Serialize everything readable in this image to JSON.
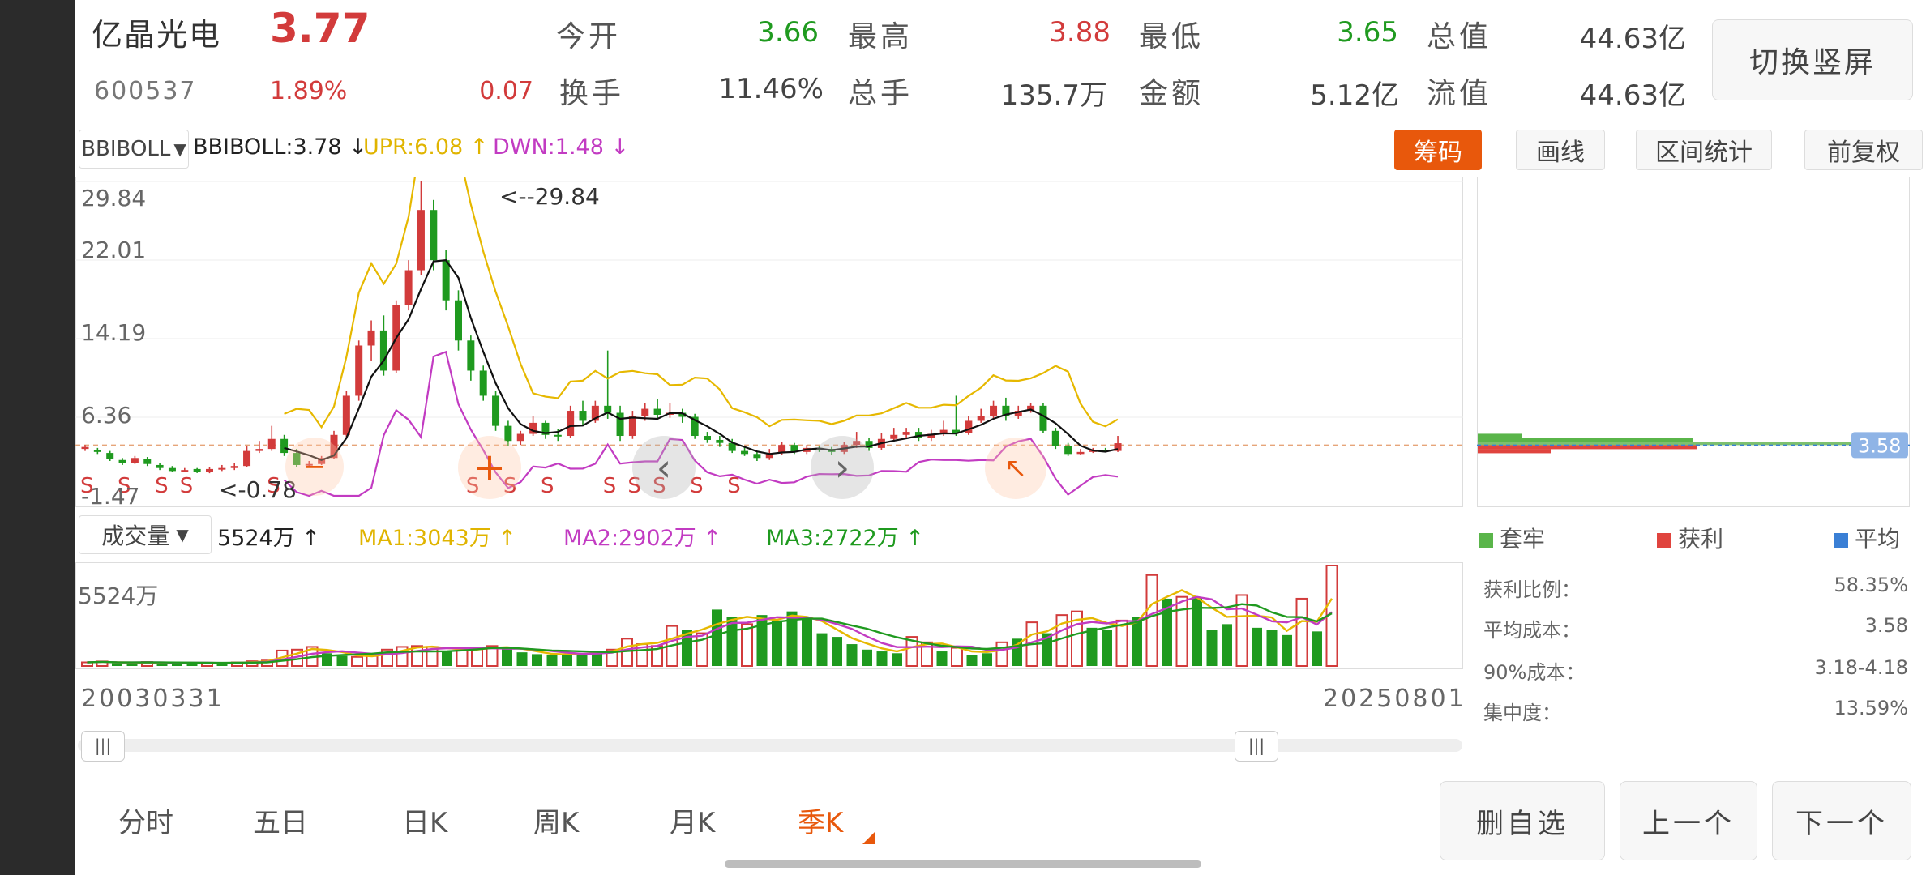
{
  "quote": {
    "name": "亿晶光电",
    "price": "3.77",
    "code": "600537",
    "change_pct": "1.89%",
    "change": "0.07",
    "open_label": "今开",
    "open": "3.66",
    "high_label": "最高",
    "high": "3.88",
    "low_label": "最低",
    "low": "3.65",
    "total_mv_label": "总值",
    "total_mv": "44.63亿",
    "turnover_label": "换手",
    "turnover": "11.46%",
    "volume_label": "总手",
    "volume": "135.7万",
    "amount_label": "金额",
    "amount": "5.12亿",
    "float_mv_label": "流值",
    "float_mv": "44.63亿",
    "switch_btn": "切换竖屏"
  },
  "indicator": {
    "selector": "BBIBOLL",
    "bbiboll": "BBIBOLL:3.78 ↓",
    "upr": "UPR:6.08 ↑",
    "dwn": "DWN:1.48 ↓",
    "buttons": [
      "筹码",
      "画线",
      "区间统计",
      "前复权"
    ]
  },
  "volume_bar": {
    "selector": "成交量",
    "vol": "5524万 ↑",
    "ma1": "MA1:3043万 ↑",
    "ma2": "MA2:2902万 ↑",
    "ma3": "MA3:2722万 ↑",
    "axis_max": "5524万"
  },
  "colors": {
    "up": "#d23b3b",
    "down": "#1f9a1f",
    "boll_upper": "#e6b800",
    "boll_mid": "#111111",
    "boll_lower": "#c23bc2",
    "accent": "#e8580c"
  },
  "chart_data": {
    "type": "candlestick",
    "period": "季K",
    "y_ticks": [
      "29.84",
      "22.01",
      "14.19",
      "6.36",
      "-1.47"
    ],
    "ylim": [
      -1.47,
      29.84
    ],
    "x_start": "20030331",
    "x_end": "20250801",
    "max_label": "<--29.84",
    "min_label": "<-0.78",
    "current_price_line": 3.58,
    "signals": [
      "S",
      "S",
      "S",
      "S",
      "S",
      "S",
      "S",
      "S",
      "S",
      "S",
      "S",
      "S",
      "S"
    ],
    "candles": [
      [
        3.2,
        3.4,
        3.6,
        3.0
      ],
      [
        3.1,
        2.9,
        3.3,
        2.7
      ],
      [
        2.8,
        2.2,
        3.0,
        2.0
      ],
      [
        2.1,
        1.8,
        2.3,
        1.6
      ],
      [
        1.8,
        2.3,
        2.5,
        1.7
      ],
      [
        2.2,
        1.7,
        2.4,
        1.5
      ],
      [
        1.6,
        1.3,
        1.8,
        1.1
      ],
      [
        1.3,
        1.0,
        1.5,
        0.9
      ],
      [
        1.0,
        1.1,
        1.3,
        0.9
      ],
      [
        1.2,
        0.9,
        1.3,
        0.8
      ],
      [
        0.9,
        1.2,
        1.4,
        0.78
      ],
      [
        1.2,
        1.3,
        1.6,
        1.0
      ],
      [
        1.3,
        1.5,
        1.8,
        1.1
      ],
      [
        1.5,
        3.0,
        3.5,
        1.4
      ],
      [
        3.0,
        3.2,
        4.0,
        2.8
      ],
      [
        3.2,
        4.2,
        5.5,
        3.0
      ],
      [
        4.2,
        2.8,
        4.6,
        2.5
      ],
      [
        2.8,
        1.6,
        3.2,
        1.4
      ],
      [
        1.6,
        1.7,
        2.0,
        1.5
      ],
      [
        1.7,
        2.3,
        2.5,
        1.6
      ],
      [
        2.3,
        4.6,
        5.0,
        2.2
      ],
      [
        4.6,
        8.5,
        9.0,
        4.4
      ],
      [
        8.5,
        13.5,
        14.0,
        8.0
      ],
      [
        13.5,
        15.0,
        16.0,
        12.0
      ],
      [
        15.0,
        11.0,
        16.5,
        10.5
      ],
      [
        11.0,
        17.5,
        18.0,
        10.8
      ],
      [
        17.5,
        21.0,
        22.0,
        17.0
      ],
      [
        21.0,
        27.0,
        29.84,
        20.5
      ],
      [
        27.0,
        22.0,
        28.0,
        21.0
      ],
      [
        22.0,
        18.0,
        23.0,
        17.0
      ],
      [
        18.0,
        14.0,
        19.0,
        13.0
      ],
      [
        14.0,
        11.0,
        14.5,
        10.0
      ],
      [
        11.0,
        8.5,
        11.5,
        8.0
      ],
      [
        8.5,
        5.5,
        9.0,
        5.0
      ],
      [
        5.5,
        4.0,
        6.0,
        3.5
      ],
      [
        4.0,
        4.7,
        5.0,
        3.6
      ],
      [
        4.7,
        5.8,
        6.5,
        4.5
      ],
      [
        5.8,
        4.6,
        6.0,
        4.2
      ],
      [
        4.6,
        4.5,
        5.2,
        4.0
      ],
      [
        4.5,
        7.0,
        7.5,
        4.3
      ],
      [
        7.0,
        6.0,
        8.0,
        5.5
      ],
      [
        6.0,
        7.5,
        8.0,
        5.8
      ],
      [
        7.5,
        6.8,
        13.0,
        6.2
      ],
      [
        6.8,
        4.5,
        7.5,
        4.0
      ],
      [
        4.5,
        6.5,
        7.0,
        4.2
      ],
      [
        6.5,
        7.2,
        7.8,
        6.0
      ],
      [
        7.2,
        6.6,
        8.2,
        6.2
      ],
      [
        6.6,
        6.8,
        7.8,
        6.3
      ],
      [
        6.8,
        6.4,
        7.2,
        5.8
      ],
      [
        6.4,
        4.5,
        6.7,
        4.2
      ],
      [
        4.5,
        4.1,
        4.9,
        3.8
      ],
      [
        4.1,
        3.8,
        4.5,
        3.4
      ],
      [
        3.8,
        3.0,
        4.2,
        2.8
      ],
      [
        3.0,
        2.7,
        3.4,
        2.5
      ],
      [
        2.7,
        2.3,
        3.0,
        2.0
      ],
      [
        2.3,
        2.8,
        3.2,
        2.1
      ],
      [
        2.8,
        3.6,
        3.9,
        2.6
      ],
      [
        3.6,
        2.9,
        3.8,
        2.7
      ],
      [
        2.9,
        3.3,
        3.6,
        2.7
      ],
      [
        3.3,
        3.2,
        3.5,
        2.9
      ],
      [
        3.2,
        2.9,
        3.4,
        2.6
      ],
      [
        2.9,
        3.6,
        3.9,
        2.7
      ],
      [
        3.6,
        4.0,
        4.9,
        3.3
      ],
      [
        4.0,
        3.3,
        4.3,
        3.0
      ],
      [
        3.3,
        4.2,
        4.8,
        3.1
      ],
      [
        4.2,
        4.6,
        5.3,
        3.9
      ],
      [
        4.6,
        4.9,
        5.3,
        4.3
      ],
      [
        4.9,
        4.3,
        5.3,
        4.0
      ],
      [
        4.3,
        4.7,
        5.1,
        4.0
      ],
      [
        4.7,
        5.1,
        6.0,
        4.5
      ],
      [
        5.1,
        4.8,
        8.5,
        4.5
      ],
      [
        4.8,
        6.0,
        6.5,
        4.6
      ],
      [
        6.0,
        6.5,
        7.2,
        5.8
      ],
      [
        6.5,
        7.5,
        8.0,
        6.2
      ],
      [
        7.5,
        6.5,
        8.3,
        6.0
      ],
      [
        6.5,
        7.0,
        7.5,
        6.2
      ],
      [
        7.0,
        7.5,
        7.8,
        6.8
      ],
      [
        7.5,
        5.0,
        7.8,
        4.8
      ],
      [
        5.0,
        3.5,
        5.3,
        3.2
      ],
      [
        3.5,
        2.7,
        3.8,
        2.5
      ],
      [
        2.7,
        2.9,
        3.2,
        2.6
      ],
      [
        2.9,
        3.1,
        3.3,
        2.8
      ],
      [
        3.1,
        3.0,
        3.3,
        2.9
      ],
      [
        3.0,
        3.77,
        4.5,
        2.9
      ]
    ],
    "volume_ticks": [
      "5524万"
    ],
    "volume": [
      [
        200,
        1
      ],
      [
        250,
        1
      ],
      [
        150,
        0
      ],
      [
        180,
        0
      ],
      [
        220,
        1
      ],
      [
        170,
        0
      ],
      [
        160,
        0
      ],
      [
        150,
        0
      ],
      [
        180,
        1
      ],
      [
        170,
        0
      ],
      [
        200,
        1
      ],
      [
        260,
        1
      ],
      [
        300,
        1
      ],
      [
        850,
        1
      ],
      [
        900,
        1
      ],
      [
        1050,
        1
      ],
      [
        700,
        0
      ],
      [
        550,
        0
      ],
      [
        500,
        1
      ],
      [
        550,
        1
      ],
      [
        900,
        1
      ],
      [
        1050,
        1
      ],
      [
        1100,
        1
      ],
      [
        1050,
        1
      ],
      [
        800,
        0
      ],
      [
        900,
        1
      ],
      [
        1000,
        1
      ],
      [
        1100,
        1
      ],
      [
        1000,
        0
      ],
      [
        750,
        0
      ],
      [
        650,
        0
      ],
      [
        600,
        0
      ],
      [
        650,
        0
      ],
      [
        700,
        0
      ],
      [
        800,
        0
      ],
      [
        900,
        1
      ],
      [
        1500,
        1
      ],
      [
        1200,
        1
      ],
      [
        1100,
        1
      ],
      [
        2200,
        1
      ],
      [
        2000,
        0
      ],
      [
        1800,
        1
      ],
      [
        3100,
        0
      ],
      [
        2700,
        0
      ],
      [
        2300,
        1
      ],
      [
        2800,
        0
      ],
      [
        2500,
        0
      ],
      [
        3000,
        0
      ],
      [
        2600,
        0
      ],
      [
        1800,
        0
      ],
      [
        1600,
        0
      ],
      [
        1200,
        0
      ],
      [
        900,
        0
      ],
      [
        800,
        0
      ],
      [
        700,
        0
      ],
      [
        1600,
        1
      ],
      [
        1300,
        1
      ],
      [
        800,
        0
      ],
      [
        1000,
        1
      ],
      [
        600,
        0
      ],
      [
        700,
        0
      ],
      [
        1300,
        1
      ],
      [
        1500,
        0
      ],
      [
        2400,
        1
      ],
      [
        1800,
        0
      ],
      [
        2800,
        1
      ],
      [
        3000,
        1
      ],
      [
        2100,
        0
      ],
      [
        2000,
        0
      ],
      [
        2500,
        1
      ],
      [
        2700,
        0
      ],
      [
        5000,
        1
      ],
      [
        3700,
        0
      ],
      [
        3800,
        1
      ],
      [
        3800,
        0
      ],
      [
        2000,
        0
      ],
      [
        2300,
        0
      ],
      [
        3900,
        1
      ],
      [
        2100,
        0
      ],
      [
        2000,
        0
      ],
      [
        1700,
        0
      ],
      [
        3700,
        1
      ],
      [
        1900,
        0
      ],
      [
        5524,
        1
      ]
    ]
  },
  "chips": {
    "legend": [
      "套牢",
      "获利",
      "平均"
    ],
    "legend_colors": [
      "#5ab54a",
      "#e0443e",
      "#3a7fd5"
    ],
    "avg_label": "3.58",
    "rows": [
      {
        "label": "获利比例：",
        "value": "58.35%"
      },
      {
        "label": "平均成本：",
        "value": "3.58"
      },
      {
        "label": "90%成本：",
        "value": "3.18-4.18"
      },
      {
        "label": "集中度：",
        "value": "13.59%"
      }
    ]
  },
  "bottom_tabs": [
    "分时",
    "五日",
    "日K",
    "周K",
    "月K",
    "季K"
  ],
  "active_tab": "季K",
  "bottom_buttons": [
    "删自选",
    "上一个",
    "下一个"
  ]
}
